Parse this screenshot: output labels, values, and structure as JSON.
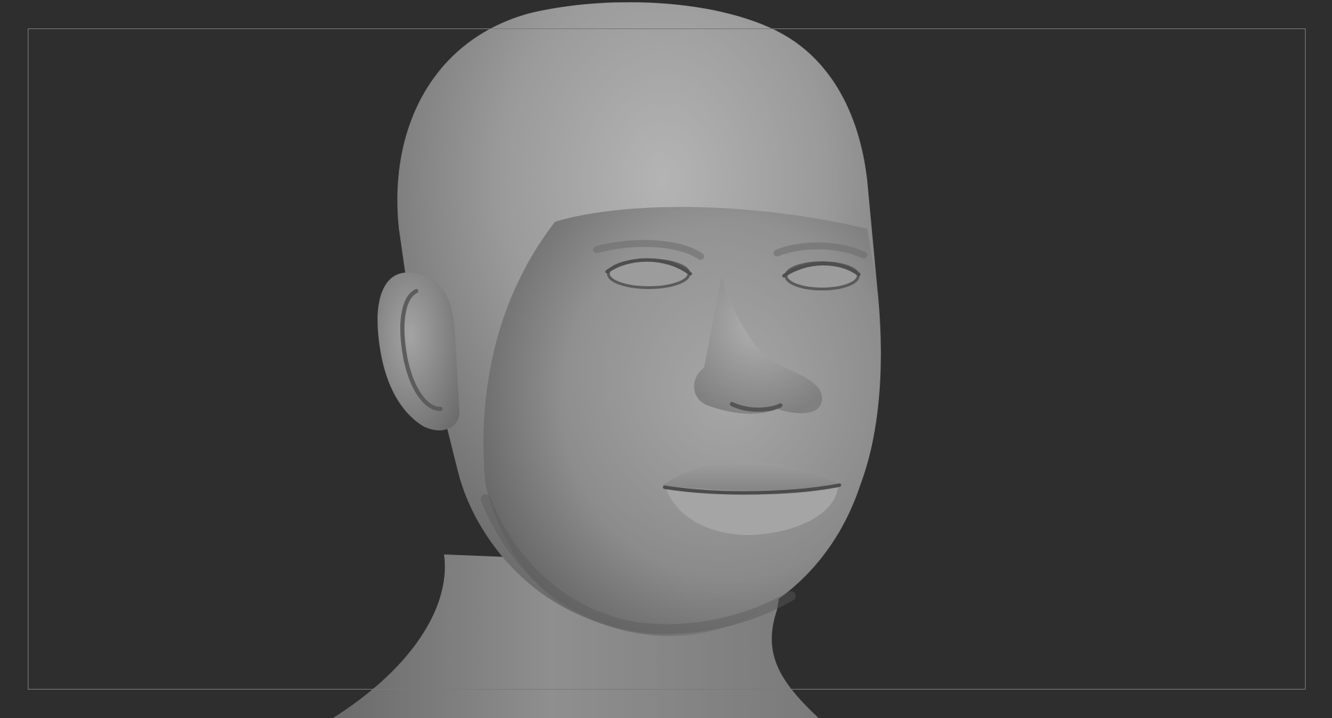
{
  "viewport": {
    "background_color": "#2e2e2e",
    "frame_color": "#7a7a7a",
    "model_color": "#8a8a8a",
    "model_highlight_color": "#b8b8b8",
    "model_shadow_color": "#4a4a4a"
  },
  "model": {
    "subject": "sculpted-human-head-bust",
    "material": "gray-clay"
  }
}
